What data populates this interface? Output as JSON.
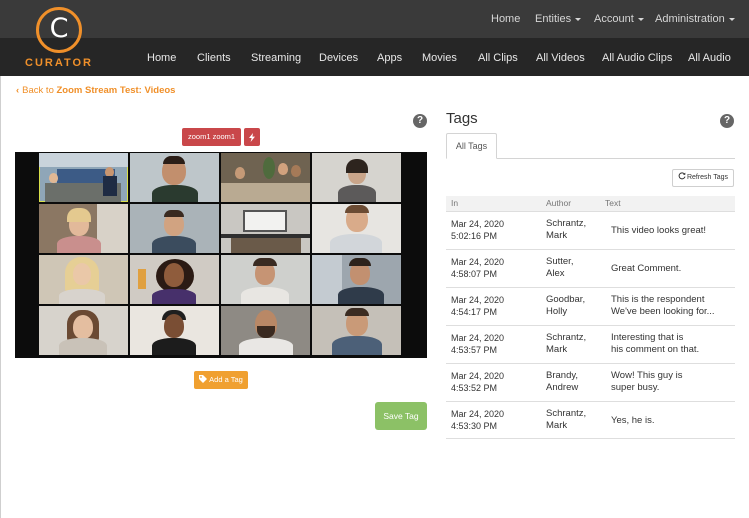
{
  "brand": {
    "letter": "C",
    "name": "CURATOR",
    "accent": "#f0902a"
  },
  "top_menu": {
    "home": "Home",
    "entities": "Entities",
    "account": "Account",
    "administration": "Administration"
  },
  "main_menu": {
    "home": "Home",
    "clients": "Clients",
    "streaming": "Streaming",
    "devices": "Devices",
    "apps": "Apps",
    "movies": "Movies",
    "all_clips": "All Clips",
    "all_videos": "All Videos",
    "all_audio_clips": "All Audio Clips",
    "all_audio": "All Audio"
  },
  "back_link": {
    "prefix": "Back to",
    "title": "Zoom Stream Test: Videos"
  },
  "help_glyph": "?",
  "video_panel": {
    "tag_chip_label": "zoom1 zoom1",
    "tag_chip_icon": "bolt-icon",
    "tag_chip_remove": "ϟ",
    "add_tag_label": "Add a Tag",
    "add_tag_icon": "tag-icon",
    "save_tag_label": "Save Tag"
  },
  "tags_panel": {
    "heading": "Tags",
    "tab_all": "All Tags",
    "refresh_label": "Refresh Tags",
    "refresh_icon": "refresh-icon",
    "columns": {
      "in": "In",
      "author": "Author",
      "text": "Text"
    },
    "rows": [
      {
        "date": "Mar 24, 2020",
        "time": "5:02:16 PM",
        "author_last": "Schrantz,",
        "author_first": "Mark",
        "text1": "This video looks great!",
        "text2": ""
      },
      {
        "date": "Mar 24, 2020",
        "time": "4:58:07 PM",
        "author_last": "Sutter,",
        "author_first": "Alex",
        "text1": "Great Comment.",
        "text2": ""
      },
      {
        "date": "Mar 24, 2020",
        "time": "4:54:17 PM",
        "author_last": "Goodbar,",
        "author_first": "Holly",
        "text1": "This is the respondent",
        "text2": "We've been looking for..."
      },
      {
        "date": "Mar 24, 2020",
        "time": "4:53:57 PM",
        "author_last": "Schrantz,",
        "author_first": "Mark",
        "text1": "Interesting that is",
        "text2": "his comment on that."
      },
      {
        "date": "Mar 24, 2020",
        "time": "4:53:52 PM",
        "author_last": "Brandy,",
        "author_first": "Andrew",
        "text1": "Wow! This guy is",
        "text2": "super busy."
      },
      {
        "date": "Mar 24, 2020",
        "time": "4:53:30 PM",
        "author_last": "Schrantz,",
        "author_first": "Mark",
        "text1": "Yes, he is.",
        "text2": ""
      }
    ]
  }
}
